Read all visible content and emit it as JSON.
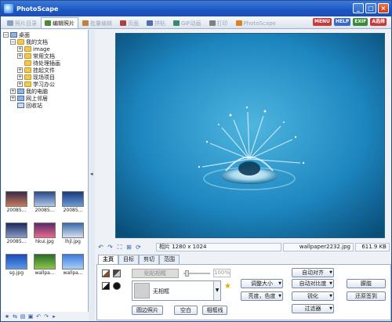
{
  "app": {
    "title": "PhotoScape"
  },
  "tabs": [
    {
      "label": "照片目录",
      "icon": "photo-folder-icon",
      "color": "#8aa0c0"
    },
    {
      "label": "编辑照片",
      "icon": "edit-photo-icon",
      "color": "#4a8a3a"
    },
    {
      "label": "批量编辑",
      "icon": "batch-edit-icon",
      "color": "#c08040"
    },
    {
      "label": "页面",
      "icon": "page-icon",
      "color": "#b04040"
    },
    {
      "label": "拼贴",
      "icon": "combine-icon",
      "color": "#4a70b0"
    },
    {
      "label": "GIF动画",
      "icon": "gif-icon",
      "color": "#3a8a6a"
    },
    {
      "label": "打印",
      "icon": "print-icon",
      "color": "#808080"
    },
    {
      "label": "PhotoScape",
      "icon": "photoscape-icon",
      "color": "#e08020"
    }
  ],
  "header_badges": [
    {
      "label": "MENU",
      "color": "#c83a3a"
    },
    {
      "label": "HELP",
      "color": "#3a6ac8"
    },
    {
      "label": "EXIF",
      "color": "#3a8a3a"
    },
    {
      "label": "A选择",
      "color": "#c83a3a"
    }
  ],
  "folder_tree": [
    {
      "label": "桌面",
      "indent": 0,
      "expander": "−",
      "icon": "desktop-icon"
    },
    {
      "label": "我的文档",
      "indent": 1,
      "expander": "−",
      "icon": "folder-icon"
    },
    {
      "label": "image",
      "indent": 2,
      "expander": "+",
      "icon": "folder-icon"
    },
    {
      "label": "常用文档",
      "indent": 2,
      "expander": "+",
      "icon": "folder-icon"
    },
    {
      "label": "待处理插画",
      "indent": 2,
      "expander": "",
      "icon": "folder-icon"
    },
    {
      "label": "挂起文件",
      "indent": 2,
      "expander": "+",
      "icon": "folder-icon"
    },
    {
      "label": "现场项目",
      "indent": 2,
      "expander": "+",
      "icon": "folder-icon"
    },
    {
      "label": "学习办公",
      "indent": 2,
      "expander": "+",
      "icon": "folder-icon"
    },
    {
      "label": "我的电脑",
      "indent": 1,
      "expander": "+",
      "icon": "computer-icon"
    },
    {
      "label": "网上邻居",
      "indent": 1,
      "expander": "+",
      "icon": "network-icon"
    },
    {
      "label": "回收站",
      "indent": 1,
      "expander": "",
      "icon": "recycle-bin-icon"
    }
  ],
  "thumbnails": [
    {
      "label": "20085...",
      "c1": "#3a2a4a",
      "c2": "#c87a5a"
    },
    {
      "label": "20085...",
      "c1": "#2a4a8a",
      "c2": "#b0c8e8"
    },
    {
      "label": "20085...",
      "c1": "#1a3a7a",
      "c2": "#6a9ad8"
    },
    {
      "label": "20085...",
      "c1": "#1a2a5a",
      "c2": "#8a9ac8"
    },
    {
      "label": "hkui.jpg",
      "c1": "#5a2a6a",
      "c2": "#e86a8a"
    },
    {
      "label": "lhjl.jpg",
      "c1": "#3a6aa8",
      "c2": "#d8e0f0"
    },
    {
      "label": "sg.jpg",
      "c1": "#1a4ab8",
      "c2": "#5a9ae8"
    },
    {
      "label": "wallpa...",
      "c1": "#2a6a2a",
      "c2": "#8ac84a"
    },
    {
      "label": "wallpa...",
      "c1": "#3a7ad8",
      "c2": "#a8d0f8"
    }
  ],
  "status": {
    "size_label": "相片 1280 x 1024",
    "filename": "wallpaper2232.jpg",
    "filesize": "611.9 KB"
  },
  "edit_tabs": [
    "主页",
    "目标",
    "剪切",
    "范围"
  ],
  "frame": {
    "placeholder": "贴贴相框",
    "percent": "100%",
    "selected": "无相框"
  },
  "buttons": {
    "round_photo": "圆边照片",
    "margin": "空白",
    "frame_line": "相框线",
    "auto_level": "自动对齐",
    "resize": "调整大小",
    "auto_contrast": "自动对比度",
    "bright_color": "亮度，色度",
    "sharpen": "锐化",
    "filter": "过滤器",
    "backlight": "朦胧",
    "deblur": "还原签到"
  }
}
